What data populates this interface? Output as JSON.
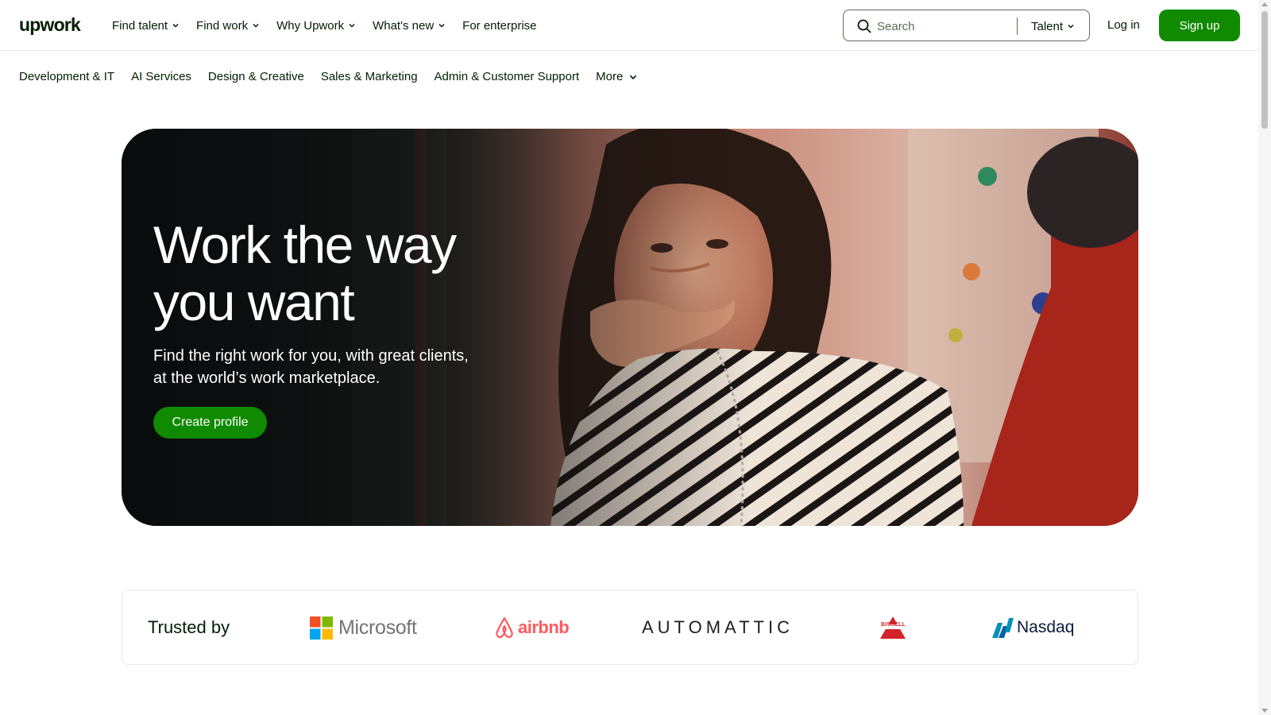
{
  "header": {
    "logo": "upwork",
    "nav": [
      {
        "label": "Find talent",
        "has_dropdown": true
      },
      {
        "label": "Find work",
        "has_dropdown": true
      },
      {
        "label": "Why Upwork",
        "has_dropdown": true
      },
      {
        "label": "What's new",
        "has_dropdown": true
      },
      {
        "label": "For enterprise",
        "has_dropdown": false
      }
    ],
    "search": {
      "placeholder": "Search",
      "value": "",
      "type_selector": "Talent"
    },
    "login_label": "Log in",
    "signup_label": "Sign up"
  },
  "categories": {
    "items": [
      "Development & IT",
      "AI Services",
      "Design & Creative",
      "Sales & Marketing",
      "Admin & Customer Support"
    ],
    "more_label": "More"
  },
  "hero": {
    "title_line1": "Work the way",
    "title_line2": "you want",
    "subtitle_line1": "Find the right work for you, with great clients,",
    "subtitle_line2": "at the world’s work marketplace.",
    "cta_label": "Create profile"
  },
  "trusted": {
    "label": "Trusted by",
    "brands": {
      "microsoft": "Microsoft",
      "airbnb": "airbnb",
      "automattic": "AUTOMATTIC",
      "bissell": "BISSELL",
      "nasdaq": "Nasdaq"
    }
  },
  "colors": {
    "brand_green": "#108a00",
    "text_dark": "#001e00",
    "border": "#e4ebe4",
    "airbnb_red": "#ff5a5f"
  },
  "icons": [
    "search-icon",
    "chevron-down-icon"
  ]
}
